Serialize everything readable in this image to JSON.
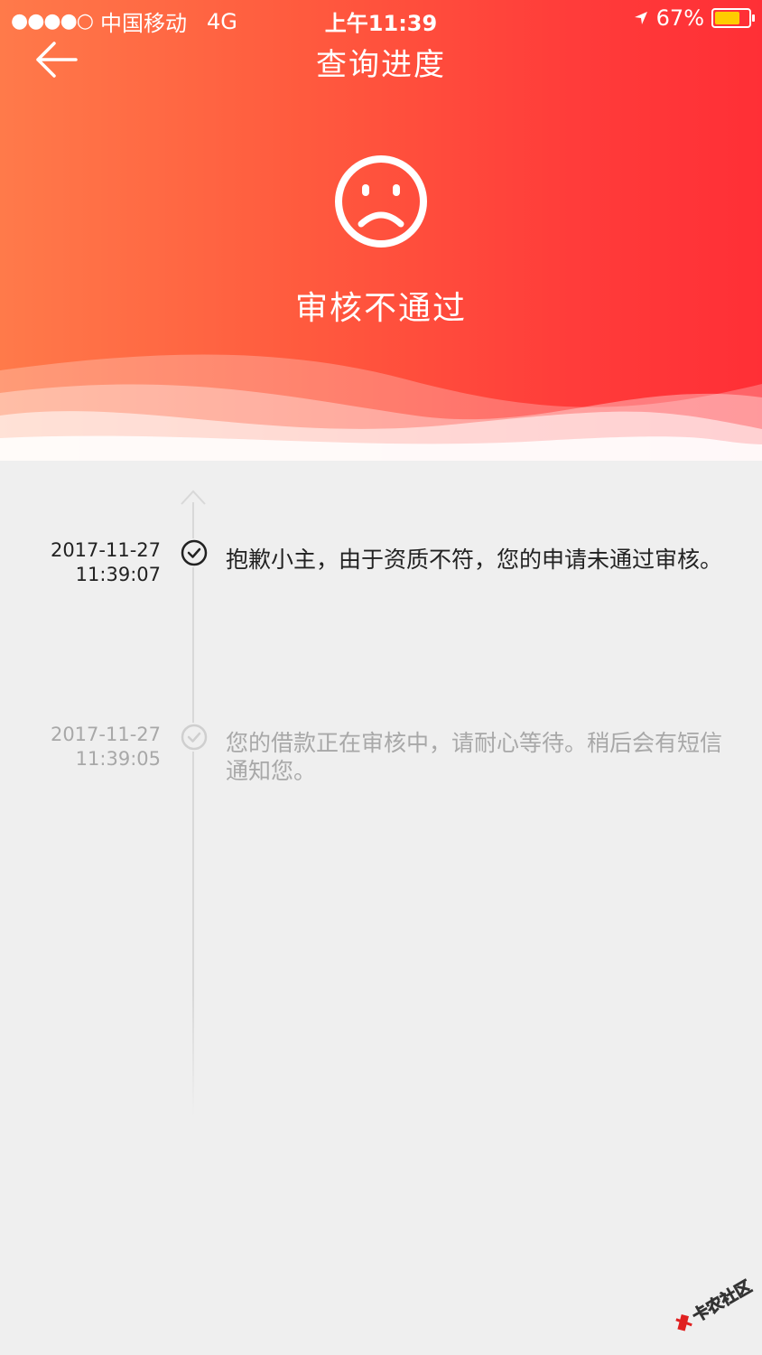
{
  "status_bar": {
    "signal": "●●●●○",
    "carrier": "中国移动",
    "network": "4G",
    "time": "上午11:39",
    "battery_percent": "67%"
  },
  "nav": {
    "title": "查询进度"
  },
  "result": {
    "title": "审核不通过"
  },
  "timeline": [
    {
      "date": "2017-11-27",
      "time": "11:39:07",
      "message": "抱歉小主，由于资质不符，您的申请未通过审核。"
    },
    {
      "date": "2017-11-27",
      "time": "11:39:05",
      "message": "您的借款正在审核中，请耐心等待。稍后会有短信通知您。"
    }
  ],
  "watermark": {
    "text": "卡农社区"
  },
  "colors": {
    "header_start": "#ff7a4a",
    "header_end": "#ff2f36",
    "battery": "#ffcc00",
    "background": "#efefef"
  }
}
